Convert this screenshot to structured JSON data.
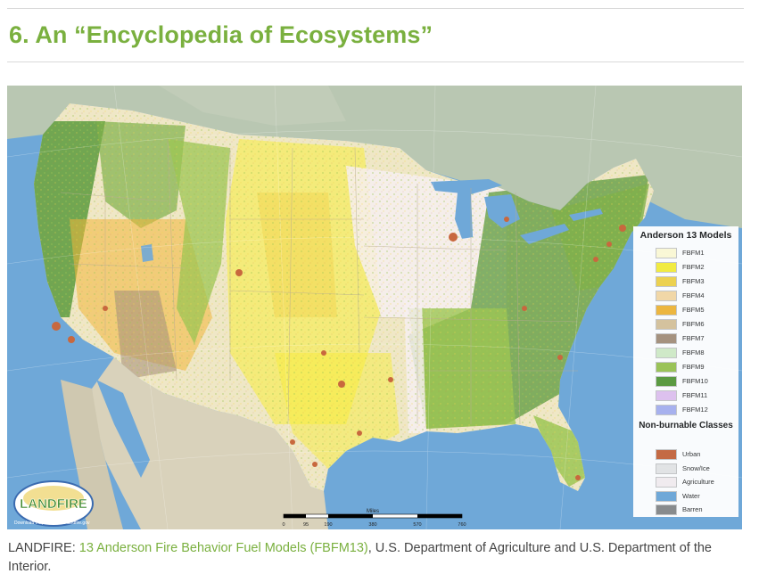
{
  "heading": "6. An “Encyclopedia of Ecosystems”",
  "map": {
    "logo_text": "LANDFIRE",
    "logo_tagline": "Download maps & data at landfire.gov",
    "scale_units": "Miles",
    "scale_ticks": [
      "0",
      "95",
      "190",
      "380",
      "570",
      "760"
    ],
    "legend": {
      "title": "Anderson 13 Models",
      "models": [
        {
          "label": "FBFM1",
          "color": "#fffbd6"
        },
        {
          "label": "FBFM2",
          "color": "#f7ee3c"
        },
        {
          "label": "FBFM3",
          "color": "#f2d34b"
        },
        {
          "label": "FBFM4",
          "color": "#f7d9a6"
        },
        {
          "label": "FBFM5",
          "color": "#f2b73a"
        },
        {
          "label": "FBFM6",
          "color": "#d9c49c"
        },
        {
          "label": "FBFM7",
          "color": "#a8927c"
        },
        {
          "label": "FBFM8",
          "color": "#d3ecc8"
        },
        {
          "label": "FBFM9",
          "color": "#9cc553"
        },
        {
          "label": "FBFM10",
          "color": "#5b9a3c"
        },
        {
          "label": "FBFM11",
          "color": "#e2c3ef"
        },
        {
          "label": "FBFM12",
          "color": "#aab2ef"
        }
      ],
      "nonburnable_title": "Non-burnable Classes",
      "nonburnable": [
        {
          "label": "Urban",
          "color": "#c8683e"
        },
        {
          "label": "Snow/Ice",
          "color": "#e6e6e6"
        },
        {
          "label": "Agriculture",
          "color": "#f6eef0"
        },
        {
          "label": "Water",
          "color": "#6fa8d8"
        },
        {
          "label": "Barren",
          "color": "#8a8a8a"
        }
      ]
    }
  },
  "caption": {
    "prefix": "LANDFIRE: ",
    "link_text": "13 Anderson Fire Behavior Fuel Models (FBFM13)",
    "suffix": ", U.S. Department of Agriculture and U.S. Department of the Interior."
  },
  "colors": {
    "heading_green": "#7ab03f",
    "ocean": "#6fa8d8",
    "canada": "#b9c7b2",
    "mexico": "#d9d2bb"
  }
}
